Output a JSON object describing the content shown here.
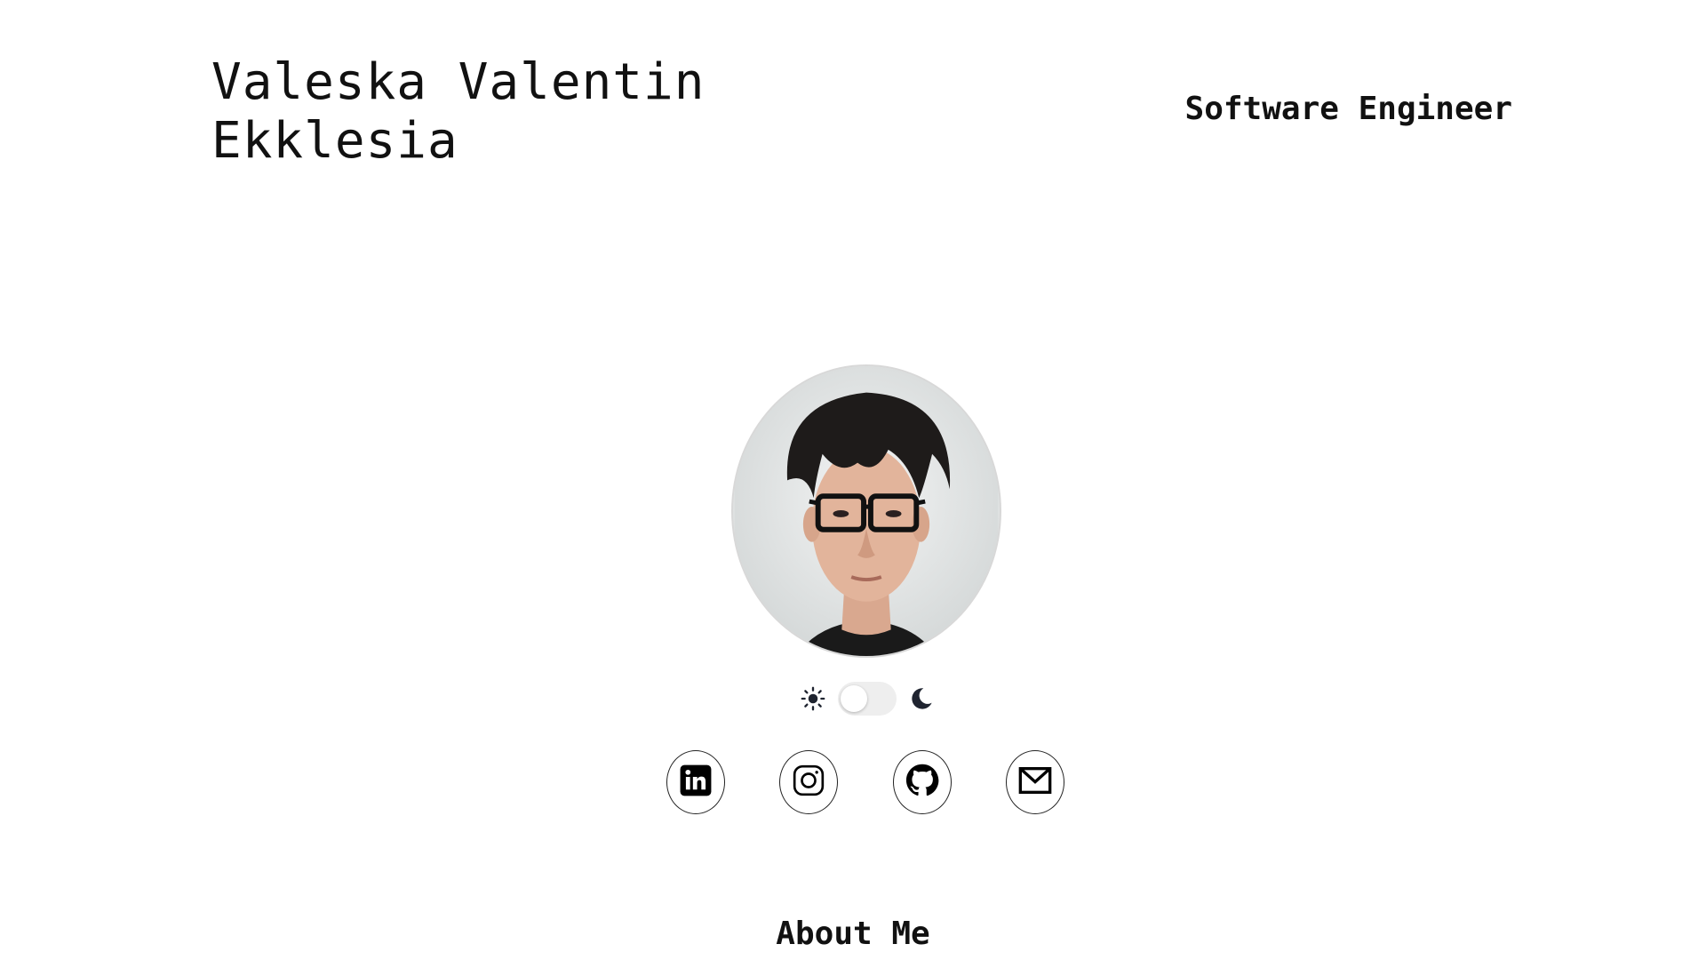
{
  "header": {
    "name_line1": "Valeska Valentin",
    "name_line2": "Ekklesia",
    "role": "Software Engineer"
  },
  "profile": {
    "avatar_alt": "profile photo"
  },
  "theme_toggle": {
    "sun_icon": "sun-icon",
    "moon_icon": "moon-icon",
    "is_dark": false
  },
  "socials": [
    {
      "icon": "linkedin-icon"
    },
    {
      "icon": "instagram-icon"
    },
    {
      "icon": "github-icon"
    },
    {
      "icon": "mail-icon"
    }
  ],
  "sections": {
    "about_title": "About Me"
  },
  "colors": {
    "background": "#ffffff",
    "text": "#111111"
  }
}
